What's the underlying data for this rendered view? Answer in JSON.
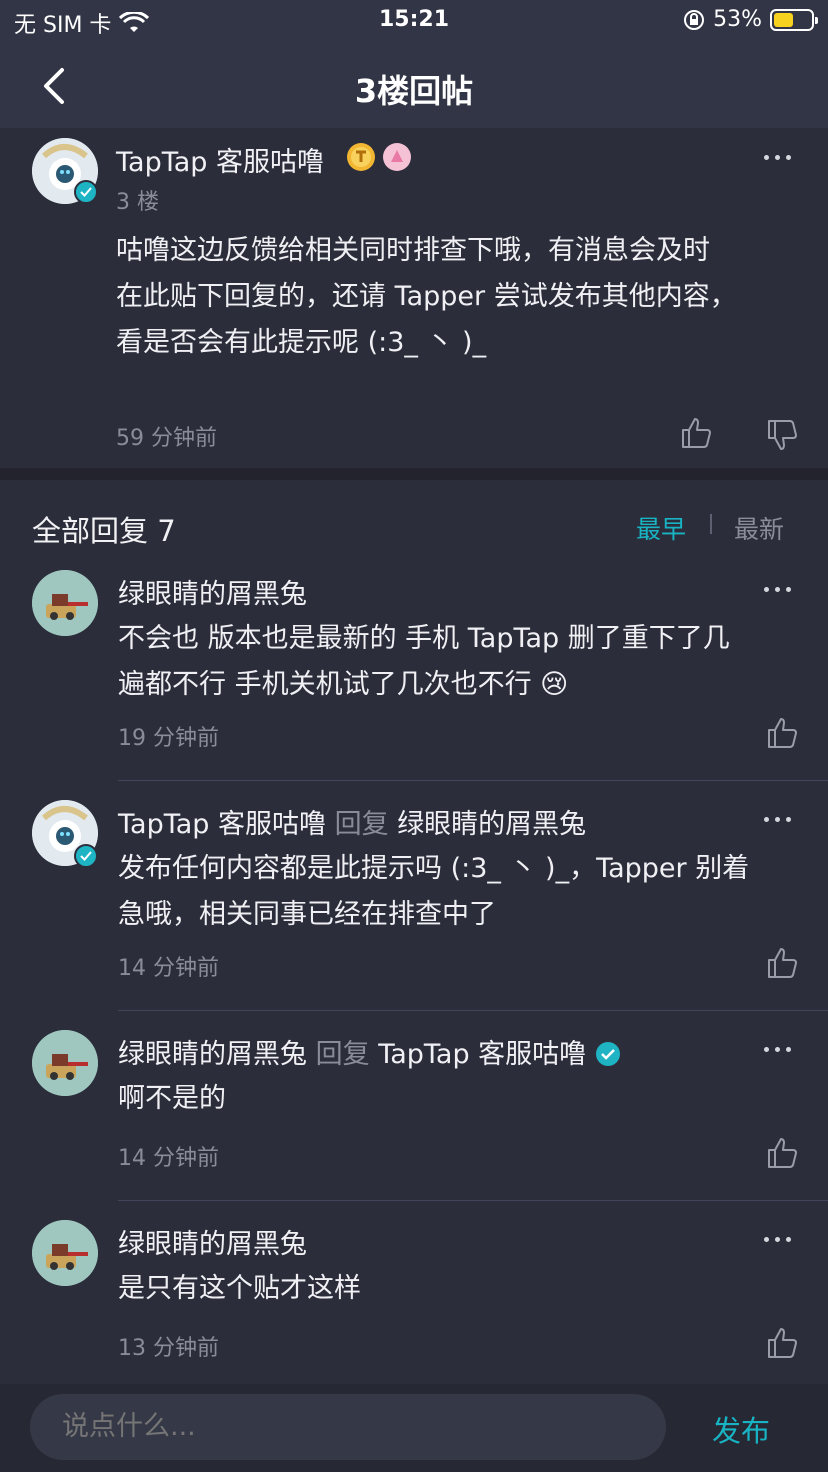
{
  "status_bar": {
    "carrier": "无 SIM 卡",
    "time": "15:21",
    "battery": "53%",
    "battery_level": 0.53
  },
  "nav": {
    "title": "3楼回帖"
  },
  "main_post": {
    "username": "TapTap 客服咕噜",
    "floor": "3 楼",
    "content_lines": [
      "咕噜这边反馈给相关同时排查下哦，有消息会及时",
      "在此贴下回复的，还请 Tapper 尝试发布其他内容，",
      "看是否会有此提示呢 (:3_ 丶 )_"
    ],
    "time": "59 分钟前"
  },
  "replies_header": {
    "title": "全部回复 7",
    "sort_early": "最早",
    "sort_new": "最新"
  },
  "replies": [
    {
      "username": "绿眼睛的屑黑兔",
      "reply_word": "",
      "reply_to": "",
      "content_lines": [
        "不会也 版本也是最新的 手机 TapTap 删了重下了几",
        "遍都不行 手机关机试了几次也不行 😢"
      ],
      "time": "19 分钟前"
    },
    {
      "username": "TapTap 客服咕噜",
      "reply_word": "回复",
      "reply_to": "绿眼睛的屑黑兔",
      "content_lines": [
        "发布任何内容都是此提示吗 (:3_ 丶 )_，Tapper 别着",
        "急哦，相关同事已经在排查中了"
      ],
      "time": "14 分钟前"
    },
    {
      "username": "绿眼睛的屑黑兔",
      "reply_word": "回复",
      "reply_to": "TapTap 客服咕噜",
      "content_lines": [
        "啊不是的"
      ],
      "time": "14 分钟前"
    },
    {
      "username": "绿眼睛的屑黑兔",
      "reply_word": "",
      "reply_to": "",
      "content_lines": [
        "是只有这个贴才这样"
      ],
      "time": "13 分钟前"
    }
  ],
  "bottom_bar": {
    "placeholder": "说点什么...",
    "post_label": "发布"
  },
  "colors": {
    "accent": "#18b4c4",
    "background": "#2b2d3a",
    "header": "#323545"
  }
}
